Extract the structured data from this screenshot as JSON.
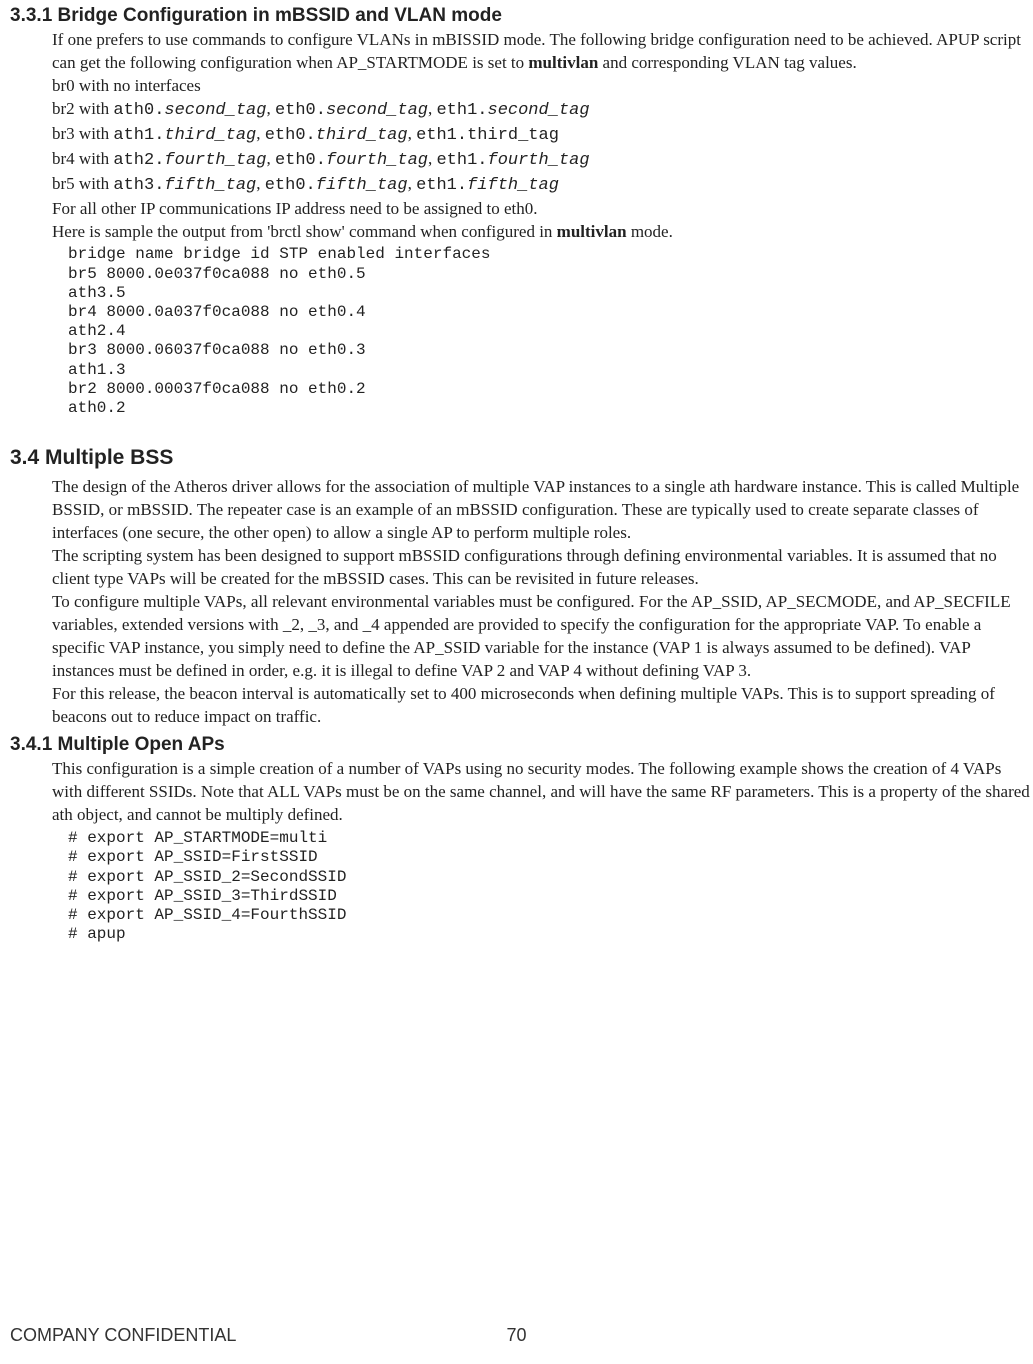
{
  "section331": {
    "heading": "3.3.1 Bridge Configuration in mBSSID and VLAN mode",
    "p1_a": "If one prefers to use commands to configure VLANs in mBISSID mode. The following bridge configuration need to be achieved. APUP script can get the following configuration when AP_STARTMODE is set to ",
    "p1_bold": "multivlan",
    "p1_b": " and corresponding VLAN tag values.",
    "br0": "br0 with no interfaces",
    "br2_prefix": "br2 with ",
    "br2_a": "ath0.",
    "br2_ai": "second_tag",
    "br2_sep1": ", ",
    "br2_b": "eth0.",
    "br2_bi": "second_tag",
    "br2_sep2": ", ",
    "br2_c": "eth1.",
    "br2_ci": "second_tag",
    "br3_prefix": "br3 with ",
    "br3_a": "ath1.",
    "br3_ai": "third_tag",
    "br3_sep1": ", ",
    "br3_b": "eth0.",
    "br3_bi": "third_tag",
    "br3_sep2": ", ",
    "br3_c": "eth1.third_tag",
    "br4_prefix": "br4 with ",
    "br4_a": "ath2.",
    "br4_ai": "fourth_tag",
    "br4_sep1": ", ",
    "br4_b": "eth0.",
    "br4_bi": "fourth_tag",
    "br4_sep2": ", ",
    "br4_c": "eth1.",
    "br4_ci": "fourth_tag",
    "br5_prefix": "br5 with ",
    "br5_a": "ath3.",
    "br5_ai": "fifth_tag",
    "br5_sep1": ", ",
    "br5_b": "eth0.",
    "br5_bi": "fifth_tag",
    "br5_sep2": ", ",
    "br5_c": "eth1.",
    "br5_ci": "fifth_tag",
    "ip_line": "For all other IP communications IP address need to be assigned to eth0.",
    "sample_a": "Here is sample the output from 'brctl show' command when configured in ",
    "sample_bold": "multivlan",
    "sample_b": " mode.",
    "code": "bridge name bridge id STP enabled interfaces\nbr5 8000.0e037f0ca088 no eth0.5\nath3.5\nbr4 8000.0a037f0ca088 no eth0.4\nath2.4\nbr3 8000.06037f0ca088 no eth0.3\nath1.3\nbr2 8000.00037f0ca088 no eth0.2\nath0.2"
  },
  "section34": {
    "heading": "3.4 Multiple BSS",
    "p1": "The design of the Atheros driver allows for the association of multiple VAP instances to a single ath hardware instance. This is called Multiple BSSID, or mBSSID. The repeater case is an example of an mBSSID configuration. These are typically used to create separate classes of interfaces (one secure, the other open) to allow a single AP to perform multiple roles.",
    "p2": "The scripting system has been designed to support mBSSID configurations through defining environmental variables. It is assumed that no client type VAPs will be created for the mBSSID cases. This can be revisited in future releases.",
    "p3": "To configure multiple VAPs, all relevant environmental variables must be configured. For the AP_SSID, AP_SECMODE, and AP_SECFILE variables, extended versions with _2, _3, and _4 appended are provided to specify the configuration for the appropriate VAP. To enable a specific VAP instance, you simply need to define the AP_SSID variable for the instance (VAP 1 is always assumed to be defined). VAP instances must be defined in order, e.g. it is illegal to define VAP 2 and VAP 4 without defining VAP 3.",
    "p4": "For this release, the beacon interval is automatically set to 400 microseconds when defining multiple VAPs. This is to support spreading of beacons out to reduce impact on traffic."
  },
  "section341": {
    "heading": "3.4.1 Multiple Open APs",
    "p1": "This configuration is a simple creation of a number of VAPs using no security modes. The following example shows the creation of 4 VAPs with different SSIDs. Note that ALL VAPs must be on the same channel, and will have the same RF parameters. This is a property of the shared ath object, and cannot be multiply defined.",
    "code": "# export AP_STARTMODE=multi\n# export AP_SSID=FirstSSID\n# export AP_SSID_2=SecondSSID\n# export AP_SSID_3=ThirdSSID\n# export AP_SSID_4=FourthSSID\n# apup"
  },
  "footer": {
    "left": "COMPANY CONFIDENTIAL",
    "page": "70"
  }
}
